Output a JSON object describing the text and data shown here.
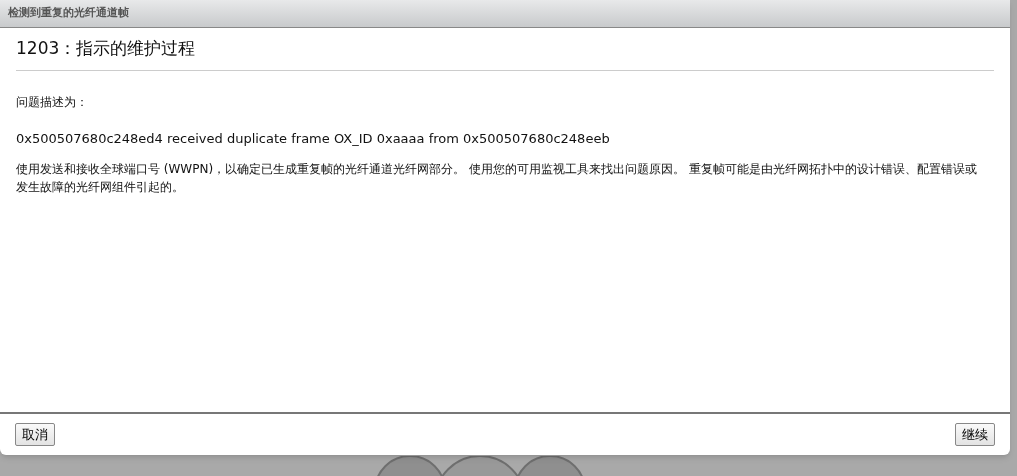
{
  "window": {
    "title": "检测到重复的光纤通道帧"
  },
  "heading": "1203：指示的维护过程",
  "description_label": "问题描述为：",
  "message": "0x500507680c248ed4 received duplicate frame OX_ID 0xaaaa from 0x500507680c248eeb",
  "explanation": "使用发送和接收全球端口号 (WWPN)，以确定已生成重复帧的光纤通道光纤网部分。 使用您的可用监视工具来找出问题原因。 重复帧可能是由光纤网拓扑中的设计错误、配置错误或发生故障的光纤网组件引起的。",
  "buttons": [
    {
      "label": "取消"
    },
    {
      "label": "继续"
    }
  ]
}
